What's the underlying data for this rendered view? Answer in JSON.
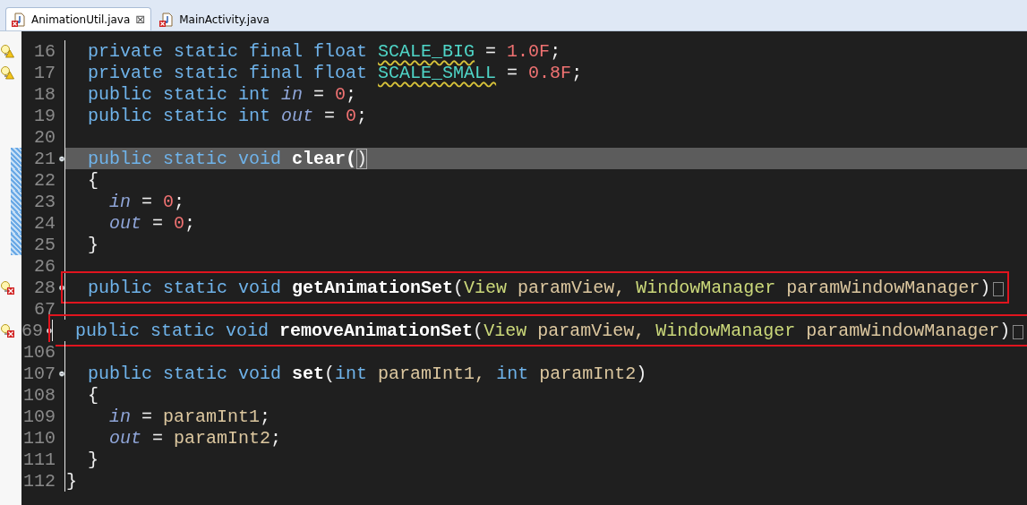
{
  "tabs": [
    {
      "label": "AnimationUtil.java",
      "selected": true,
      "close": "⊠"
    },
    {
      "label": "MainActivity.java",
      "selected": false
    }
  ],
  "lines": [
    {
      "number": "16",
      "marker": {
        "kind": "warning"
      },
      "tokens": [
        {
          "kind": "keyword",
          "text": "  private static final float "
        },
        {
          "kind": "constant",
          "text": "SCALE_BIG"
        },
        {
          "kind": "plain",
          "text": " = "
        },
        {
          "kind": "number",
          "text": "1.0F"
        },
        {
          "kind": "plain",
          "text": ";"
        }
      ]
    },
    {
      "number": "17",
      "marker": {
        "kind": "warning"
      },
      "tokens": [
        {
          "kind": "keyword",
          "text": "  private static final float "
        },
        {
          "kind": "constant",
          "text": "SCALE_SMALL"
        },
        {
          "kind": "plain",
          "text": " = "
        },
        {
          "kind": "number",
          "text": "0.8F"
        },
        {
          "kind": "plain",
          "text": ";"
        }
      ]
    },
    {
      "number": "18",
      "tokens": [
        {
          "kind": "keyword",
          "text": "  public static int "
        },
        {
          "kind": "field",
          "text": "in"
        },
        {
          "kind": "plain",
          "text": " = "
        },
        {
          "kind": "number",
          "text": "0"
        },
        {
          "kind": "plain",
          "text": ";"
        }
      ]
    },
    {
      "number": "19",
      "tokens": [
        {
          "kind": "keyword",
          "text": "  public static int "
        },
        {
          "kind": "field",
          "text": "out"
        },
        {
          "kind": "plain",
          "text": " = "
        },
        {
          "kind": "number",
          "text": "0"
        },
        {
          "kind": "plain",
          "text": ";"
        }
      ]
    },
    {
      "number": "20"
    },
    {
      "number": "21",
      "fold": {
        "kind": "collapse"
      },
      "highlighted": true,
      "in_range": true,
      "tokens": [
        {
          "kind": "keyword",
          "text": "  public static void "
        },
        {
          "kind": "method",
          "text": "clear("
        },
        {
          "kind": "bracket_match",
          "text": ")"
        }
      ]
    },
    {
      "number": "22",
      "in_range": true,
      "tokens": [
        {
          "kind": "plain",
          "text": "  {"
        }
      ]
    },
    {
      "number": "23",
      "in_range": true,
      "tokens": [
        {
          "kind": "field",
          "text": "    in"
        },
        {
          "kind": "plain",
          "text": " = "
        },
        {
          "kind": "number",
          "text": "0"
        },
        {
          "kind": "plain",
          "text": ";"
        }
      ]
    },
    {
      "number": "24",
      "in_range": true,
      "tokens": [
        {
          "kind": "field",
          "text": "    out"
        },
        {
          "kind": "plain",
          "text": " = "
        },
        {
          "kind": "number",
          "text": "0"
        },
        {
          "kind": "plain",
          "text": ";"
        }
      ]
    },
    {
      "number": "25",
      "in_range": true,
      "tokens": [
        {
          "kind": "plain",
          "text": "  }"
        }
      ]
    },
    {
      "number": "26"
    },
    {
      "number": "28",
      "marker": {
        "kind": "error"
      },
      "fold": {
        "kind": "expand"
      },
      "boxed": true,
      "folded": true,
      "tokens": [
        {
          "kind": "keyword",
          "text": "  public static void "
        },
        {
          "kind": "method",
          "text": "getAnimationSet"
        },
        {
          "kind": "plain",
          "text": "("
        },
        {
          "kind": "type",
          "text": "View"
        },
        {
          "kind": "param",
          "text": " paramView, "
        },
        {
          "kind": "type",
          "text": "WindowManager"
        },
        {
          "kind": "param",
          "text": " paramWindowManager"
        },
        {
          "kind": "plain",
          "text": ")"
        }
      ]
    },
    {
      "number": "67"
    },
    {
      "number": "69",
      "marker": {
        "kind": "error"
      },
      "fold": {
        "kind": "expand"
      },
      "boxed": true,
      "folded": true,
      "tokens": [
        {
          "kind": "keyword",
          "text": "  public static void "
        },
        {
          "kind": "method",
          "text": "removeAnimationSet"
        },
        {
          "kind": "plain",
          "text": "("
        },
        {
          "kind": "type",
          "text": "View"
        },
        {
          "kind": "param",
          "text": " paramView, "
        },
        {
          "kind": "type",
          "text": "WindowManager"
        },
        {
          "kind": "param",
          "text": " paramWindowManager"
        },
        {
          "kind": "plain",
          "text": ")"
        }
      ]
    },
    {
      "number": "106"
    },
    {
      "number": "107",
      "fold": {
        "kind": "collapse"
      },
      "tokens": [
        {
          "kind": "keyword",
          "text": "  public static void "
        },
        {
          "kind": "method",
          "text": "set"
        },
        {
          "kind": "plain",
          "text": "("
        },
        {
          "kind": "keyword",
          "text": "int"
        },
        {
          "kind": "param",
          "text": " paramInt1, "
        },
        {
          "kind": "keyword",
          "text": "int"
        },
        {
          "kind": "param",
          "text": " paramInt2"
        },
        {
          "kind": "plain",
          "text": ")"
        }
      ]
    },
    {
      "number": "108",
      "tokens": [
        {
          "kind": "plain",
          "text": "  {"
        }
      ]
    },
    {
      "number": "109",
      "tokens": [
        {
          "kind": "field",
          "text": "    in"
        },
        {
          "kind": "plain",
          "text": " = "
        },
        {
          "kind": "param",
          "text": "paramInt1"
        },
        {
          "kind": "plain",
          "text": ";"
        }
      ]
    },
    {
      "number": "110",
      "tokens": [
        {
          "kind": "field",
          "text": "    out"
        },
        {
          "kind": "plain",
          "text": " = "
        },
        {
          "kind": "param",
          "text": "paramInt2"
        },
        {
          "kind": "plain",
          "text": ";"
        }
      ]
    },
    {
      "number": "111",
      "tokens": [
        {
          "kind": "plain",
          "text": "  }"
        }
      ]
    },
    {
      "number": "112",
      "tokens": [
        {
          "kind": "plain",
          "text": "}"
        }
      ]
    }
  ]
}
